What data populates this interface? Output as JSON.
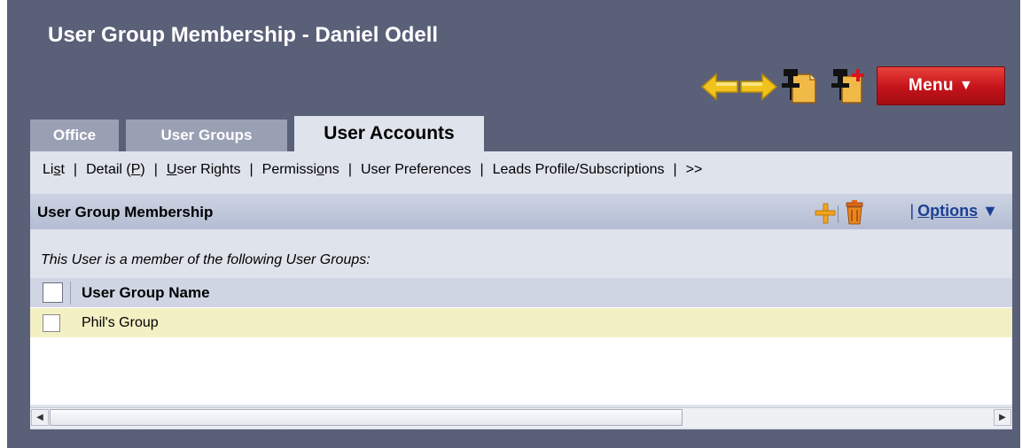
{
  "page": {
    "title": "User Group Membership - Daniel Odell"
  },
  "toolbar": {
    "menu_label": "Menu",
    "menu_arrow": "▼",
    "icons": [
      "back-arrow-icon",
      "forward-arrow-icon",
      "pin-document-icon",
      "pin-add-icon"
    ]
  },
  "tabs": [
    {
      "label": "Office",
      "active": false
    },
    {
      "label": "User Groups",
      "active": false
    },
    {
      "label": "User Accounts",
      "active": true
    }
  ],
  "subnav": {
    "items": [
      {
        "pre": "Li",
        "u": "s",
        "post": "t"
      },
      {
        "pre": "Detail (",
        "u": "P",
        "post": ")"
      },
      {
        "pre": "",
        "u": "U",
        "post": "ser Rights"
      },
      {
        "pre": "Permissi",
        "u": "o",
        "post": "ns"
      },
      {
        "pre": "User Preferences",
        "u": "",
        "post": ""
      },
      {
        "pre": "Leads Profile/Subscriptions",
        "u": "",
        "post": ""
      },
      {
        "pre": ">>",
        "u": "",
        "post": ""
      }
    ],
    "separator": "|"
  },
  "section": {
    "title": "User Group Membership",
    "options_label": "Options",
    "options_arrow": "▼",
    "options_pipe": "|"
  },
  "content": {
    "caption": "This User is a member of the following User Groups:",
    "columns": [
      "User Group Name"
    ],
    "rows": [
      {
        "name": "Phil's Group"
      }
    ]
  },
  "colors": {
    "frame": "#5b6079",
    "panel": "#dfe3ec",
    "menu_red": "#c4121a",
    "row_highlight": "#f3f0c4",
    "options_link": "#1d3f93"
  }
}
